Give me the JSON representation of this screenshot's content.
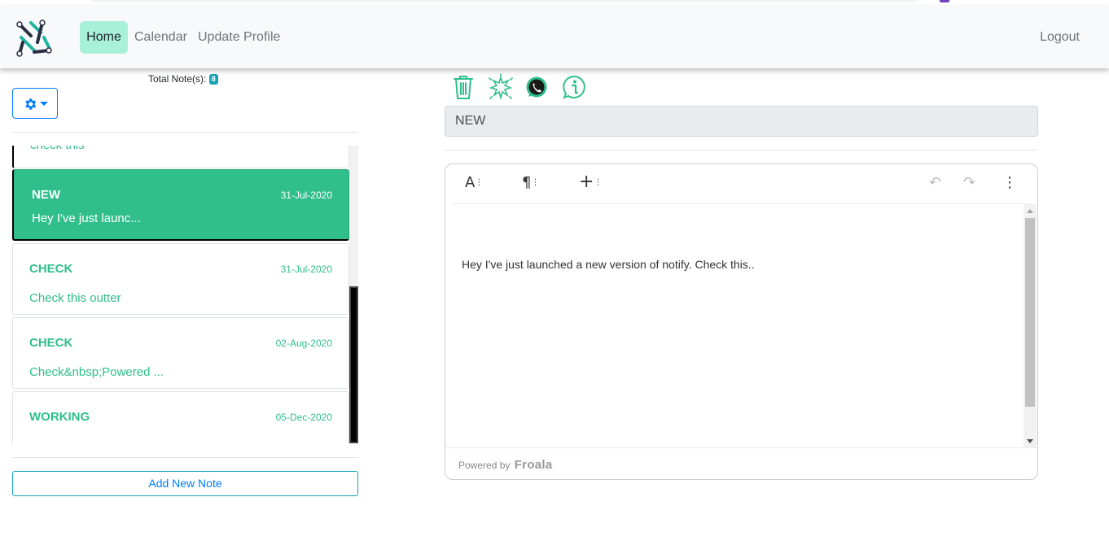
{
  "nav": {
    "home": "Home",
    "calendar": "Calendar",
    "update_profile": "Update Profile",
    "logout": "Logout",
    "active_bg": "#a8f0d8"
  },
  "sidebar": {
    "total_label": "Total Note(s):",
    "total_count": "8",
    "settings_icon": "gear-icon",
    "add_note": "Add New Note"
  },
  "notes": [
    {
      "title": "",
      "date": "",
      "preview": "check this",
      "state": "partial"
    },
    {
      "title": "NEW",
      "date": "31-Jul-2020",
      "preview": "Hey I've just launc...",
      "state": "active"
    },
    {
      "title": "CHECK",
      "date": "31-Jul-2020",
      "preview": "Check this outter",
      "state": "normal"
    },
    {
      "title": "CHECK",
      "date": "02-Aug-2020",
      "preview": "Check&nbsp;Powered ...",
      "state": "normal"
    },
    {
      "title": "WORKING",
      "date": "05-Dec-2020",
      "preview": "",
      "state": "normal"
    }
  ],
  "actions": {
    "icons": [
      "trash-icon",
      "sparkle-icon",
      "whatsapp-icon",
      "info-icon"
    ],
    "accent": "#2fbf8a"
  },
  "editor": {
    "title_value": "NEW",
    "content": "Hey I've just launched a new version of notify. Check this..",
    "toolbar": {
      "font": "A",
      "paragraph": "¶",
      "insert": "+",
      "undo": "↶",
      "redo": "↷",
      "more": "⋮"
    },
    "powered_by": "Powered by",
    "brand": "Froala"
  }
}
